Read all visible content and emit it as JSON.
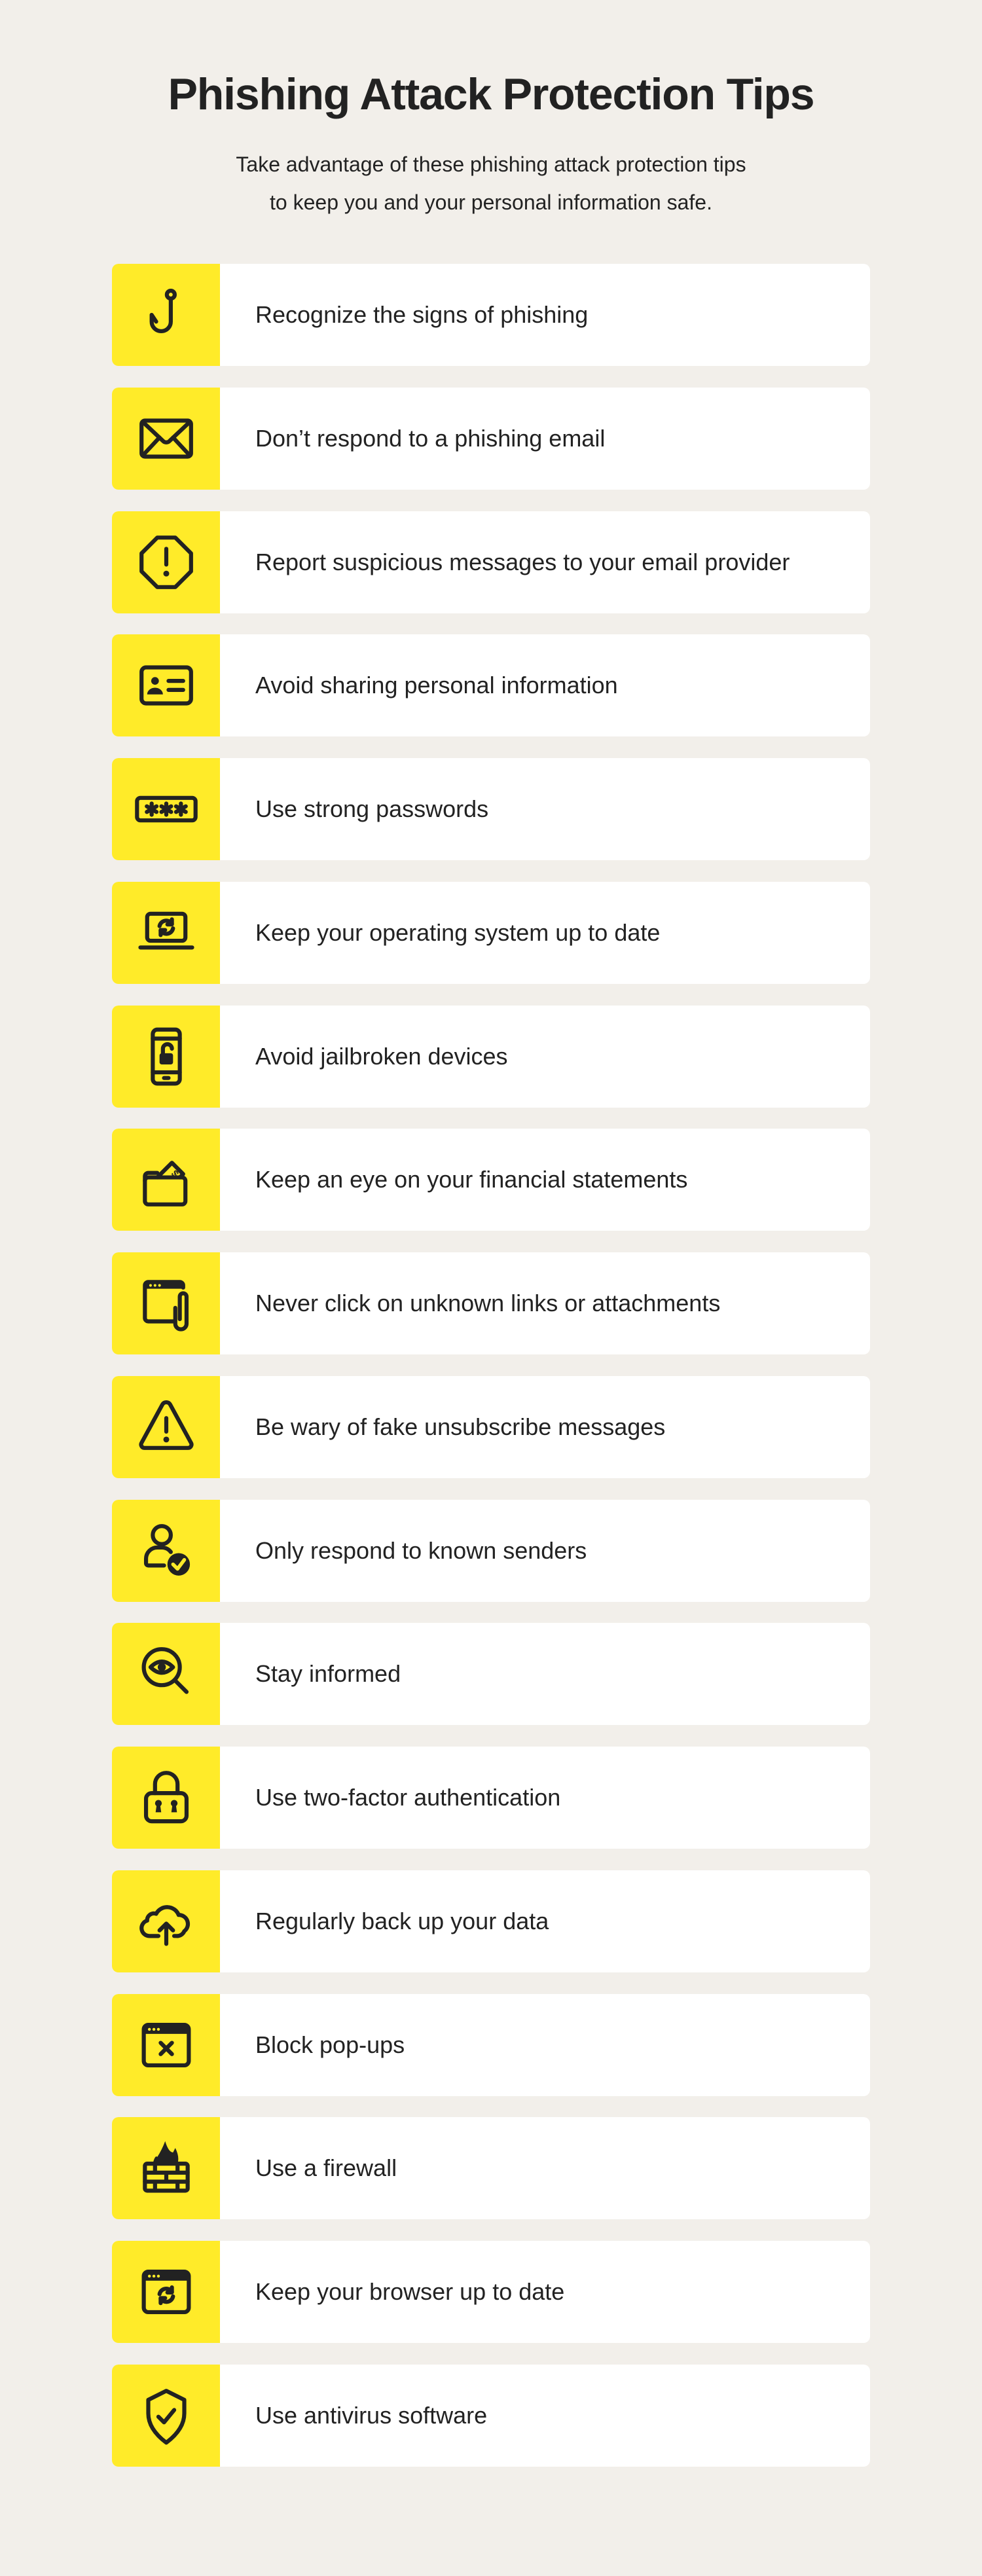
{
  "header": {
    "title": "Phishing Attack Protection Tips",
    "subtitle_line1": "Take advantage of these phishing attack protection tips",
    "subtitle_line2": "to keep you and your personal information safe."
  },
  "colors": {
    "background": "#F2EFEA",
    "accent_yellow": "#FFEB29",
    "card": "#FFFFFF",
    "text": "#222222"
  },
  "tips": [
    {
      "label": "Recognize the signs of phishing",
      "icon": "fishing-hook-icon"
    },
    {
      "label": "Don’t respond to a phishing email",
      "icon": "envelope-icon"
    },
    {
      "label": "Report suspicious messages to your email provider",
      "icon": "octagon-alert-icon"
    },
    {
      "label": "Avoid sharing personal information",
      "icon": "id-card-icon"
    },
    {
      "label": "Use strong passwords",
      "icon": "password-field-icon"
    },
    {
      "label": "Keep your operating system up to date",
      "icon": "laptop-refresh-icon"
    },
    {
      "label": "Avoid jailbroken devices",
      "icon": "phone-unlocked-icon"
    },
    {
      "label": "Keep an eye on your financial statements",
      "icon": "wallet-money-icon"
    },
    {
      "label": "Never click on unknown links or attachments",
      "icon": "window-attachment-icon"
    },
    {
      "label": "Be wary of fake unsubscribe messages",
      "icon": "warning-triangle-icon"
    },
    {
      "label": "Only respond to known senders",
      "icon": "user-verified-icon"
    },
    {
      "label": "Stay informed",
      "icon": "magnifier-eye-icon"
    },
    {
      "label": "Use two-factor authentication",
      "icon": "padlock-double-keyhole-icon"
    },
    {
      "label": "Regularly back up your data",
      "icon": "cloud-upload-icon"
    },
    {
      "label": "Block pop-ups",
      "icon": "window-close-icon"
    },
    {
      "label": "Use a firewall",
      "icon": "firewall-icon"
    },
    {
      "label": "Keep your browser up to date",
      "icon": "browser-refresh-icon"
    },
    {
      "label": "Use antivirus software",
      "icon": "shield-check-icon"
    }
  ]
}
